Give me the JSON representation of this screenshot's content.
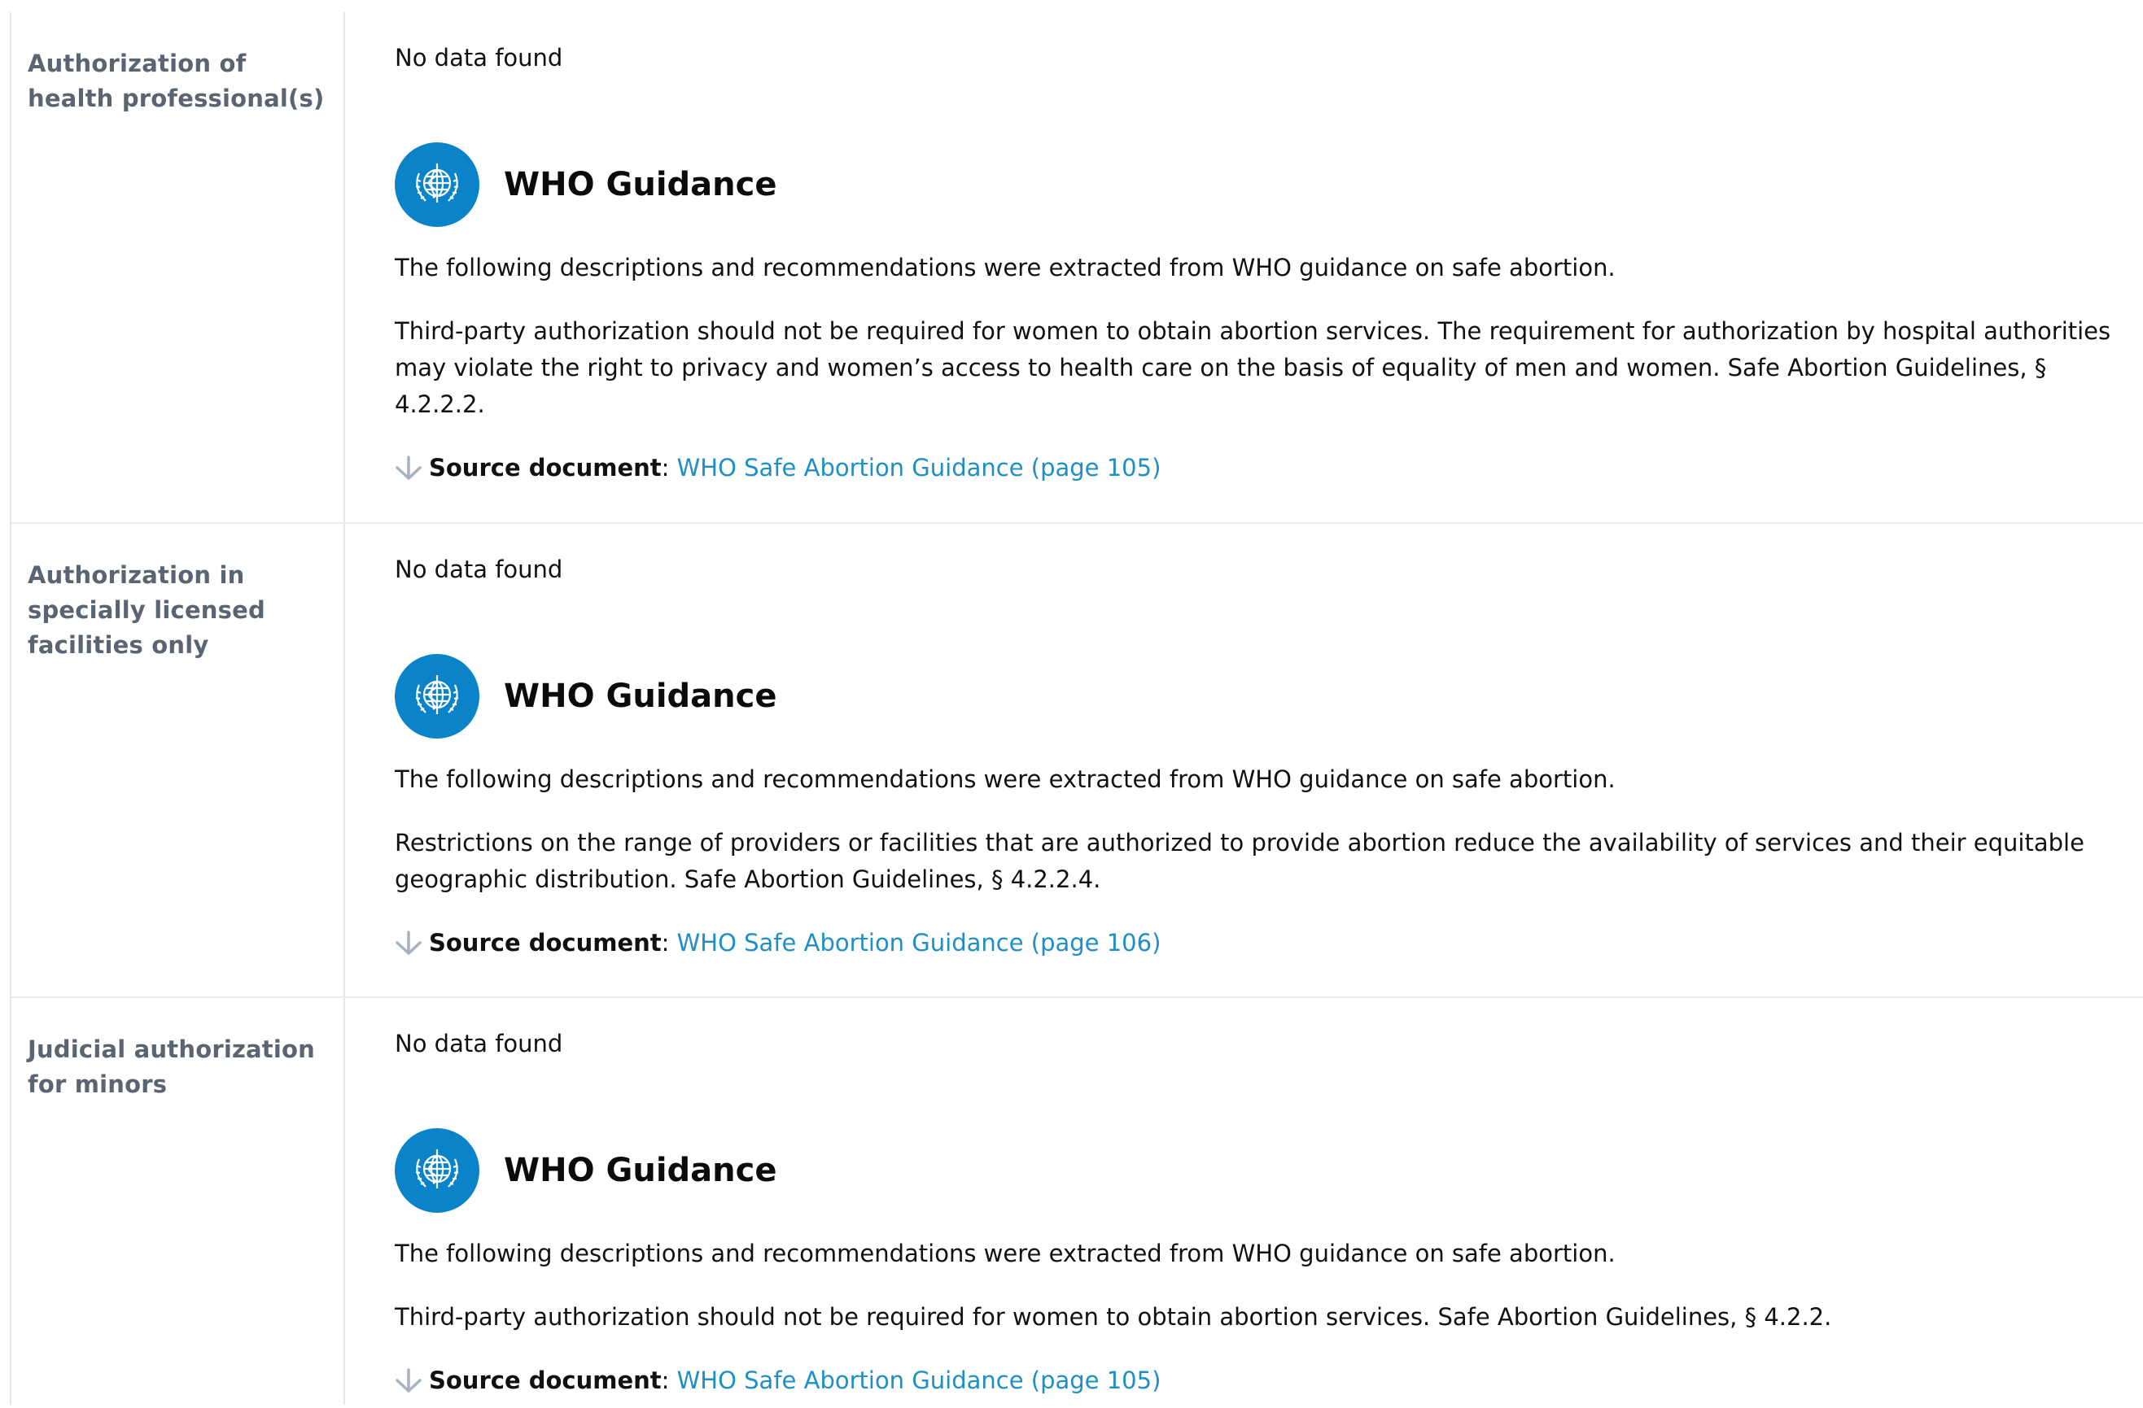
{
  "rows": [
    {
      "label": "Authorization of health professional(s)",
      "no_data": "No data found",
      "guidance_title": "WHO Guidance",
      "intro": "The following descriptions and recommendations were extracted from WHO guidance on safe abortion.",
      "body": "Third-party authorization should not be required for women to obtain abortion services. The requirement for authorization by hospital authorities may violate the right to privacy and women’s access to health care on the basis of equality of men and women. Safe Abortion Guidelines, § 4.2.2.2.",
      "source_label": "Source document",
      "source_sep": ":",
      "source_link": "WHO Safe Abortion Guidance (page 105)"
    },
    {
      "label": "Authorization in specially licensed facilities only",
      "no_data": "No data found",
      "guidance_title": "WHO Guidance",
      "intro": "The following descriptions and recommendations were extracted from WHO guidance on safe abortion.",
      "body": "Restrictions on the range of providers or facilities that are authorized to provide abortion reduce the availability of services and their equitable geographic distribution. Safe Abortion Guidelines, § 4.2.2.4.",
      "source_label": "Source document",
      "source_sep": ":",
      "source_link": "WHO Safe Abortion Guidance (page 106)"
    },
    {
      "label": "Judicial authorization for minors",
      "no_data": "No data found",
      "guidance_title": "WHO Guidance",
      "intro": "The following descriptions and recommendations were extracted from WHO guidance on safe abortion.",
      "body": "Third-party authorization should not be required for women to obtain abortion services. Safe Abortion Guidelines, § 4.2.2.",
      "source_label": "Source document",
      "source_sep": ":",
      "source_link": "WHO Safe Abortion Guidance (page 105)"
    }
  ],
  "colors": {
    "label": "#5b6572",
    "who_blue": "#0a83c9",
    "link": "#1f8fc4",
    "arrow": "#a9b3bf"
  },
  "icons": {
    "logo": "who-emblem-icon",
    "download": "arrow-down-icon"
  }
}
